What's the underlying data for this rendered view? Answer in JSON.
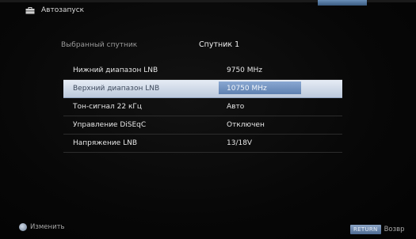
{
  "header": {
    "title": "Автозапуск",
    "icon": "briefcase-icon"
  },
  "satellite": {
    "label": "Выбранный спутник",
    "value": "Спутник 1"
  },
  "settings": [
    {
      "label": "Нижний диапазон LNB",
      "value": "9750 MHz"
    },
    {
      "label": "Верхний диапазон LNB",
      "value": "10750 MHz"
    },
    {
      "label": "Тон-сигнал 22 кГц",
      "value": "Авто"
    },
    {
      "label": "Управление DiSEqC",
      "value": "Отключен"
    },
    {
      "label": "Напряжение LNB",
      "value": "13/18V"
    }
  ],
  "footer": {
    "change_label": "Изменить",
    "return_button": "RETURN",
    "return_label": "Возвр"
  },
  "colors": {
    "selection": "#cfd9e8",
    "accent": "#5e80b0",
    "background": "#070707"
  }
}
